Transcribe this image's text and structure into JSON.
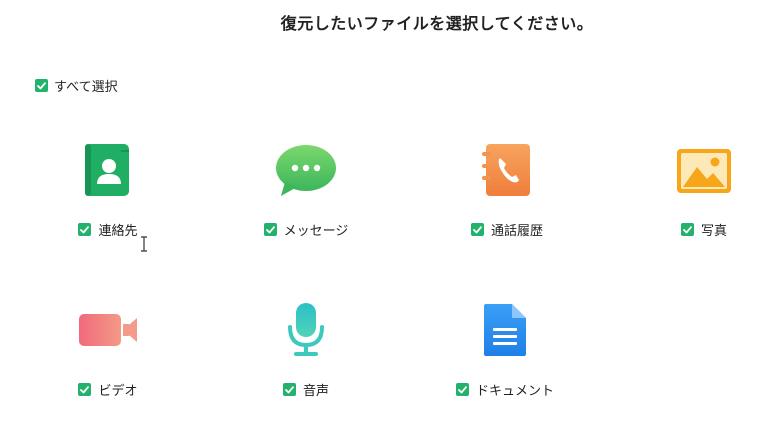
{
  "title": "復元したいファイルを選択してください。",
  "select_all": {
    "label": "すべて選択",
    "checked": true
  },
  "categories": [
    {
      "label": "連絡先",
      "icon": "contacts-icon",
      "checked": true
    },
    {
      "label": "メッセージ",
      "icon": "messages-icon",
      "checked": true
    },
    {
      "label": "通話履歴",
      "icon": "call-history-icon",
      "checked": true
    },
    {
      "label": "写真",
      "icon": "photos-icon",
      "checked": true
    },
    {
      "label": "ビデオ",
      "icon": "video-icon",
      "checked": true
    },
    {
      "label": "音声",
      "icon": "audio-icon",
      "checked": true
    },
    {
      "label": "ドキュメント",
      "icon": "document-icon",
      "checked": true
    }
  ],
  "colors": {
    "checkbox": "#23b26b",
    "contacts": "#1fae64",
    "messages": "#5ccb63",
    "call_history": "#f4934b",
    "photos": "#f7a619",
    "video": "#f27a82",
    "audio": "#38c6c0",
    "document": "#2b8ef0"
  }
}
